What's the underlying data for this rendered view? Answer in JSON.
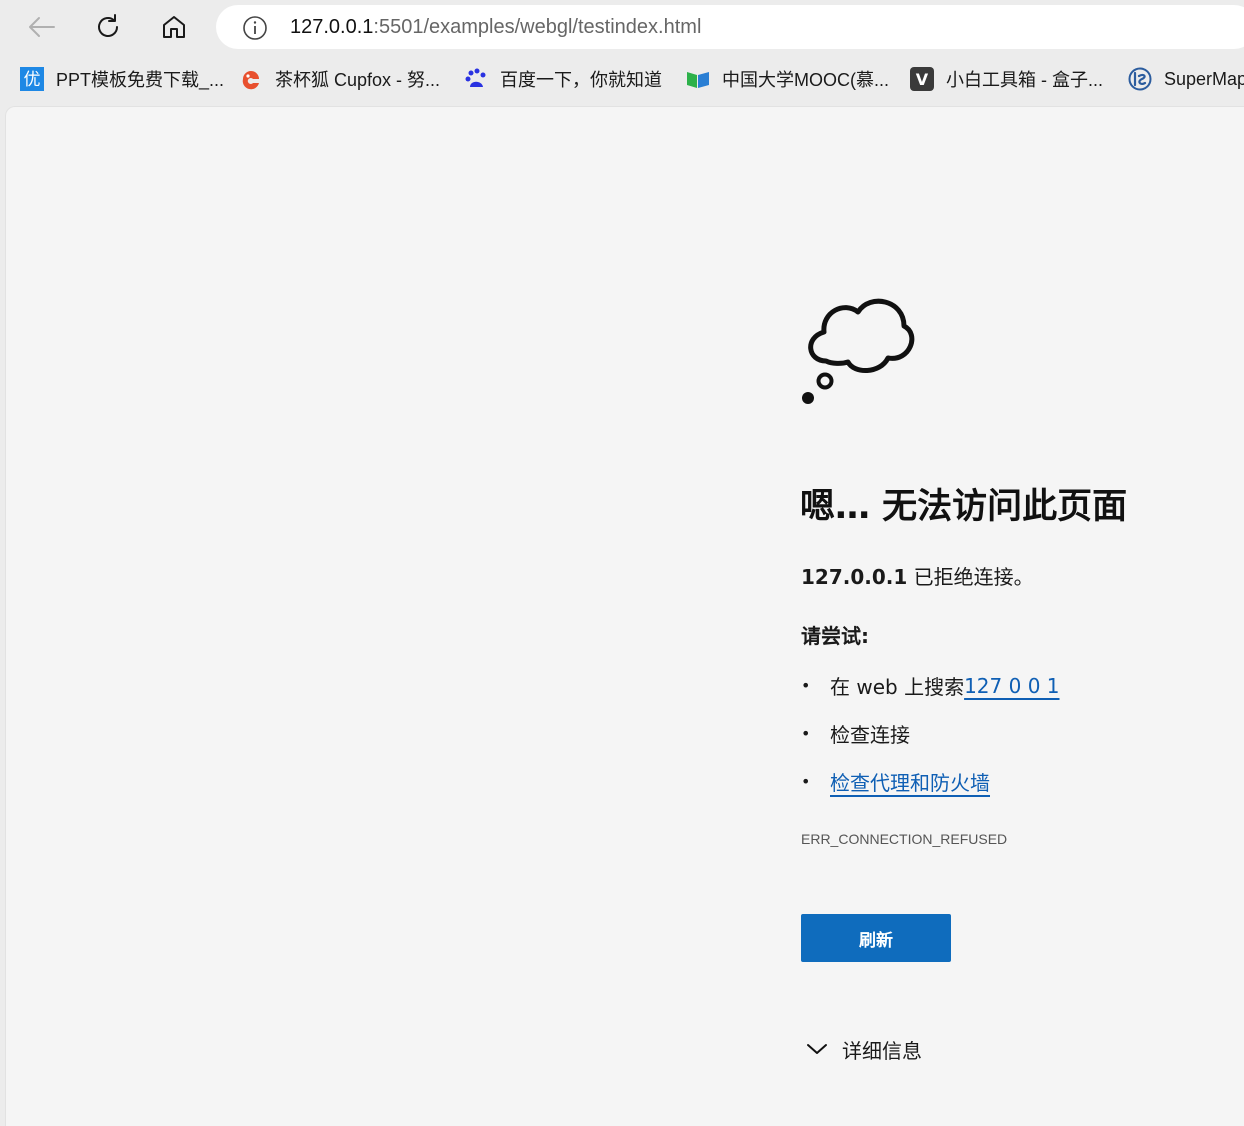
{
  "toolbar": {
    "back_icon": "arrow-left-icon",
    "reload_icon": "reload-icon",
    "home_icon": "home-icon"
  },
  "address_bar": {
    "host": "127.0.0.1",
    "rest": ":5501/examples/webgl/testindex.html",
    "info_icon": "info-icon"
  },
  "bookmarks": [
    {
      "label": "PPT模板免费下载_...",
      "icon": "you-logo-icon",
      "icon_text": "优"
    },
    {
      "label": "茶杯狐 Cupfox - 努...",
      "icon": "cupfox-logo-icon"
    },
    {
      "label": "百度一下，你就知道",
      "icon": "baidu-paw-icon"
    },
    {
      "label": "中国大学MOOC(慕...",
      "icon": "mooc-logo-icon"
    },
    {
      "label": "小白工具箱 - 盒子...",
      "icon": "v-logo-icon",
      "icon_text": "V"
    },
    {
      "label": "SuperMap",
      "icon": "supermap-logo-icon"
    }
  ],
  "error": {
    "icon": "thought-cloud-icon",
    "title": "嗯… 无法访问此页面",
    "host": "127.0.0.1",
    "message": " 已拒绝连接。",
    "try_heading": "请尝试:",
    "suggestions": [
      {
        "prefix": "在 web 上搜索 ",
        "link": "127 0 0 1"
      },
      {
        "text": "检查连接"
      },
      {
        "link": "检查代理和防火墙"
      }
    ],
    "code": "ERR_CONNECTION_REFUSED",
    "refresh_label": "刷新",
    "details_label": "详细信息"
  },
  "colors": {
    "accent": "#0f6cbd",
    "link": "#0f5fb4",
    "page_bg": "#f5f5f5",
    "chrome_bg": "#ececec"
  }
}
